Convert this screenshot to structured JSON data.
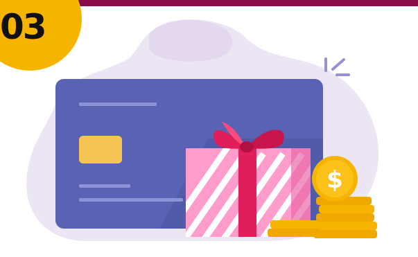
{
  "badge": {
    "number": "03"
  },
  "illustration": {
    "coin_symbol": "$",
    "colors": {
      "top_band": "#8a0b4a",
      "badge": "#f6b400",
      "blob": "#eae2f2",
      "card": "#5a63b4",
      "chip": "#f6c552",
      "gift": "#ff8fc4",
      "ribbon": "#e01e5a",
      "coin": "#fcb600"
    },
    "icons": [
      "credit-card-icon",
      "gift-box-icon",
      "dollar-coin-icon",
      "coin-stack-icon",
      "sparkle-lines-icon"
    ]
  }
}
